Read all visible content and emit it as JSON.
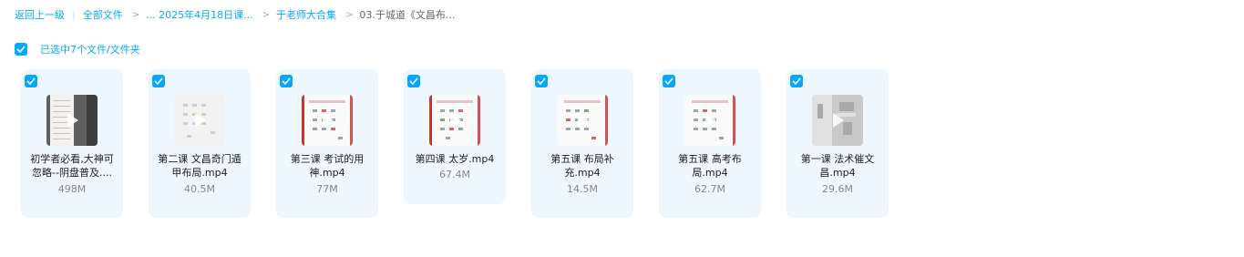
{
  "breadcrumb": {
    "back": "返回上一级",
    "all_files": "全部文件",
    "level1": "... 2025年4月18日课...",
    "level2": "于老师大合集",
    "current": "03.于城道《文昌布..."
  },
  "selection": {
    "label": "已选中7个文件/文件夹"
  },
  "colors": {
    "accent": "#06a7ff",
    "card_bg": "#eef7fe"
  },
  "files": [
    {
      "name": "初学者必看,大神可忽略--阴盘普及....",
      "size": "498M",
      "selected": true,
      "thumb": "video-dark"
    },
    {
      "name": "第二课 文昌奇门遁甲布局.mp4",
      "size": "40.5M",
      "selected": true,
      "thumb": "doc-faint"
    },
    {
      "name": "第三课 考试的用神.mp4",
      "size": "77M",
      "selected": true,
      "thumb": "doc-red"
    },
    {
      "name": "第四课 太岁.mp4",
      "size": "67.4M",
      "selected": true,
      "thumb": "doc-red"
    },
    {
      "name": "第五课 布局补充.mp4",
      "size": "14.5M",
      "selected": true,
      "thumb": "doc"
    },
    {
      "name": "第五课 高考布局.mp4",
      "size": "62.7M",
      "selected": true,
      "thumb": "doc"
    },
    {
      "name": "第一课 法术催文昌.mp4",
      "size": "29.6M",
      "selected": true,
      "thumb": "video-gray"
    }
  ]
}
